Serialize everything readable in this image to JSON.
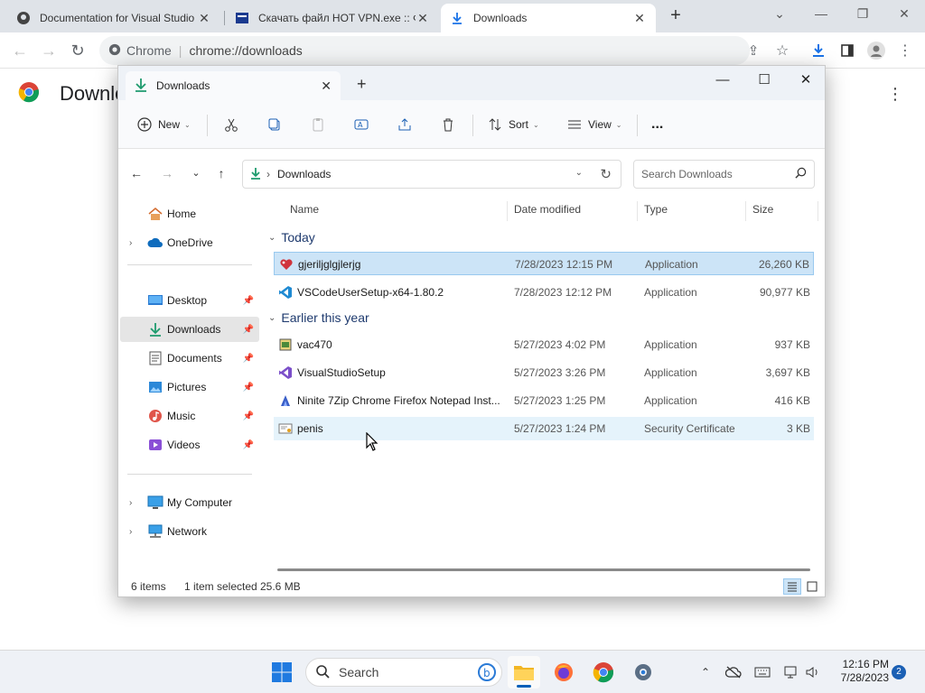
{
  "chrome": {
    "tabs": [
      {
        "label": "Documentation for Visual Studio"
      },
      {
        "label": "Скачать файл HOT VPN.exe :: Ф..."
      },
      {
        "label": "Downloads"
      }
    ],
    "omnibox": {
      "site": "Chrome",
      "url": "chrome://downloads"
    },
    "page_title": "Downloads"
  },
  "explorer": {
    "tab_label": "Downloads",
    "commands": {
      "new": "New",
      "sort": "Sort",
      "view": "View",
      "more": "..."
    },
    "address": {
      "path": "Downloads"
    },
    "search": {
      "placeholder": "Search Downloads"
    },
    "nav": {
      "home": "Home",
      "onedrive": "OneDrive",
      "desktop": "Desktop",
      "downloads": "Downloads",
      "documents": "Documents",
      "pictures": "Pictures",
      "music": "Music",
      "videos": "Videos",
      "mycomputer": "My Computer",
      "network": "Network"
    },
    "columns": {
      "name": "Name",
      "date": "Date modified",
      "type": "Type",
      "size": "Size"
    },
    "groups": [
      {
        "label": "Today",
        "files": [
          {
            "name": "gjeriljglgjlerjg",
            "date": "7/28/2023 12:15 PM",
            "type": "Application",
            "size": "26,260 KB"
          },
          {
            "name": "VSCodeUserSetup-x64-1.80.2",
            "date": "7/28/2023 12:12 PM",
            "type": "Application",
            "size": "90,977 KB"
          }
        ]
      },
      {
        "label": "Earlier this year",
        "files": [
          {
            "name": "vac470",
            "date": "5/27/2023 4:02 PM",
            "type": "Application",
            "size": "937 KB"
          },
          {
            "name": "VisualStudioSetup",
            "date": "5/27/2023 3:26 PM",
            "type": "Application",
            "size": "3,697 KB"
          },
          {
            "name": "Ninite 7Zip Chrome Firefox Notepad Inst...",
            "date": "5/27/2023 1:25 PM",
            "type": "Application",
            "size": "416 KB"
          },
          {
            "name": "penis",
            "date": "5/27/2023 1:24 PM",
            "type": "Security Certificate",
            "size": "3 KB"
          }
        ]
      }
    ],
    "status": {
      "count": "6 items",
      "selected": "1 item selected",
      "size": "25.6 MB"
    }
  },
  "taskbar": {
    "search_label": "Search",
    "time": "12:16 PM",
    "date": "7/28/2023",
    "notifications": "2"
  },
  "colors": {
    "accent": "#005fb8",
    "selection": "#cce4f7",
    "titlebar": "#eef2f7"
  }
}
